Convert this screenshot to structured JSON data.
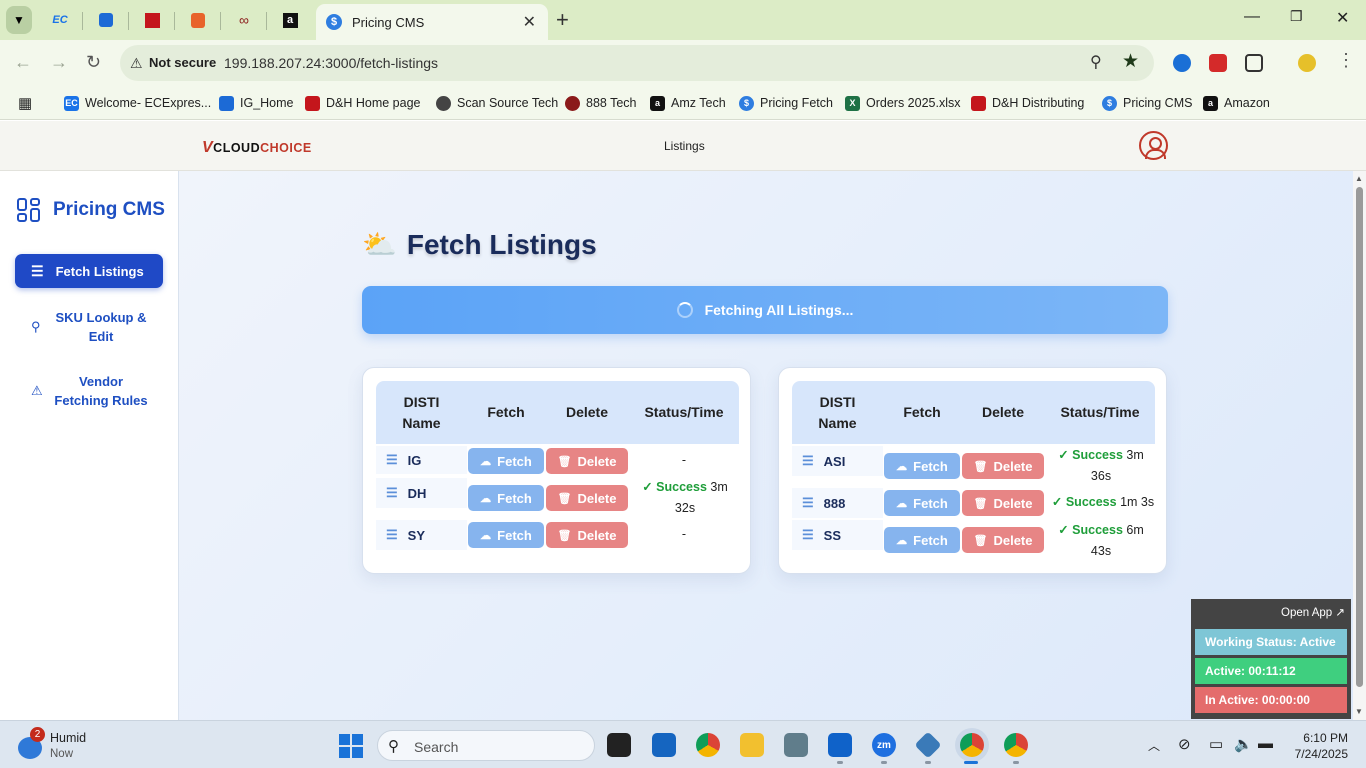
{
  "browser": {
    "active_tab": {
      "title": "Pricing CMS",
      "favicon": "$"
    },
    "url": {
      "security": "Not secure",
      "address": "199.188.207.24:3000/fetch-listings"
    },
    "bookmarks": [
      {
        "label": "Welcome- ECExpres...",
        "icon": "EC",
        "color": "#1a73e8"
      },
      {
        "label": "IG_Home",
        "icon": "IG",
        "color": "#1c6ad6"
      },
      {
        "label": "D&H Home page",
        "icon": "DH",
        "color": "#c4161c"
      },
      {
        "label": "Scan Source Tech",
        "icon": "",
        "color": "#444444"
      },
      {
        "label": "888 Tech",
        "icon": "8",
        "color": "#c0392b"
      },
      {
        "label": "Amz Tech",
        "icon": "a",
        "color": "#111111"
      },
      {
        "label": "Pricing Fetch",
        "icon": "$",
        "color": "#2e7de0"
      },
      {
        "label": "Orders 2025.xlsx",
        "icon": "X",
        "color": "#1e7145"
      },
      {
        "label": "D&H Distributing",
        "icon": "DH",
        "color": "#c4161c"
      },
      {
        "label": "Pricing CMS",
        "icon": "$",
        "color": "#2e7de0"
      },
      {
        "label": "Amazon",
        "icon": "a",
        "color": "#111111"
      }
    ]
  },
  "header": {
    "logo_v": "V",
    "logo_a": "CLOUD",
    "logo_b": "CHOICE",
    "nav_link": "Listings"
  },
  "sidebar": {
    "brand": "Pricing CMS",
    "items": [
      {
        "label": "Fetch Listings",
        "icon": "☰",
        "active": true
      },
      {
        "label": "SKU Lookup & Edit",
        "icon": "⚲"
      },
      {
        "label": "Vendor Fetching Rules",
        "icon": "⚠"
      }
    ]
  },
  "main": {
    "title": "Fetch Listings",
    "fetch_all_label": "Fetching All Listings...",
    "columns": {
      "name": "DISTI Name",
      "fetch": "Fetch",
      "delete": "Delete",
      "status": "Status/Time"
    },
    "fetch_label": "Fetch",
    "delete_label": "Delete",
    "tables": [
      {
        "rows": [
          {
            "name": "IG",
            "status": "",
            "time": "-"
          },
          {
            "name": "DH",
            "status": "Success",
            "time": "3m 32s"
          },
          {
            "name": "SY",
            "status": "",
            "time": "-"
          }
        ]
      },
      {
        "rows": [
          {
            "name": "ASI",
            "status": "Success",
            "time": "3m 36s"
          },
          {
            "name": "888",
            "status": "Success",
            "time": "1m 3s"
          },
          {
            "name": "SS",
            "status": "Success",
            "time": "6m 43s"
          }
        ]
      }
    ]
  },
  "widget": {
    "open_app": "Open App ↗",
    "working_status": "Working Status: Active",
    "active": "Active: 00:11:12",
    "inactive": "In Active: 00:00:00",
    "colors": {
      "status": "#7ec6d6",
      "active": "#3fcf7f",
      "inactive": "#e46c6c"
    }
  },
  "taskbar": {
    "weather_badge": "2",
    "weather_label": "Humid",
    "weather_sub": "Now",
    "search_placeholder": "Search",
    "time": "6:10 PM",
    "date": "7/24/2025"
  }
}
